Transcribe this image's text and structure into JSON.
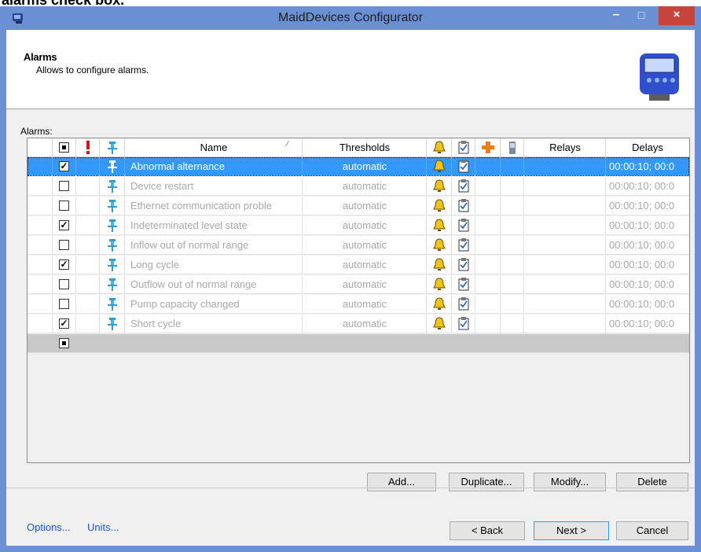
{
  "caption": {
    "text": "alarms check box."
  },
  "window": {
    "title": "MaidDevices Configurator",
    "minimize": "–",
    "maximize": "□",
    "close": "×"
  },
  "header": {
    "title": "Alarms",
    "description": "Allows to configure alarms."
  },
  "grid_label": "Alarms:",
  "columns": {
    "name": "Name",
    "thresholds": "Thresholds",
    "relays": "Relays",
    "delays": "Delays",
    "sort_glyph": "⁄"
  },
  "icons": {
    "priority": "exclamation-icon",
    "pin": "pin-icon",
    "bell": "bell-icon",
    "clipboard": "clipboard-icon",
    "plus": "plus-icon",
    "phone": "phone-icon"
  },
  "rows": [
    {
      "checked": true,
      "name": "Abnormal alternance",
      "thresholds": "automatic",
      "delays": "00:00:10; 00:0",
      "selected": true
    },
    {
      "checked": false,
      "name": "Device restart",
      "thresholds": "automatic",
      "delays": "00:00:10; 00:0"
    },
    {
      "checked": false,
      "name": "Ethernet communication proble",
      "thresholds": "automatic",
      "delays": "00:00:10; 00:0"
    },
    {
      "checked": true,
      "name": "Indeterminated level state",
      "thresholds": "automatic",
      "delays": "00:00:10; 00:0"
    },
    {
      "checked": false,
      "name": "Inflow out of normal range",
      "thresholds": "automatic",
      "delays": "00:00:10; 00:0"
    },
    {
      "checked": true,
      "name": "Long cycle",
      "thresholds": "automatic",
      "delays": "00:00:10; 00:0"
    },
    {
      "checked": false,
      "name": "Outflow out of normal range",
      "thresholds": "automatic",
      "delays": "00:00:10; 00:0"
    },
    {
      "checked": false,
      "name": "Pump capacity changed",
      "thresholds": "automatic",
      "delays": "00:00:10; 00:0"
    },
    {
      "checked": true,
      "name": "Short cycle",
      "thresholds": "automatic",
      "delays": "00:00:10; 00:0"
    }
  ],
  "buttons": {
    "add": "Add...",
    "duplicate": "Duplicate...",
    "modify": "Modify...",
    "delete": "Delete",
    "back": "< Back",
    "next": "Next >",
    "cancel": "Cancel"
  },
  "links": {
    "options": "Options...",
    "units": "Units..."
  },
  "colors": {
    "titlebar": "#6b8fd3",
    "selection": "#3399ff",
    "close": "#c7443a",
    "link": "#1a55d6"
  }
}
